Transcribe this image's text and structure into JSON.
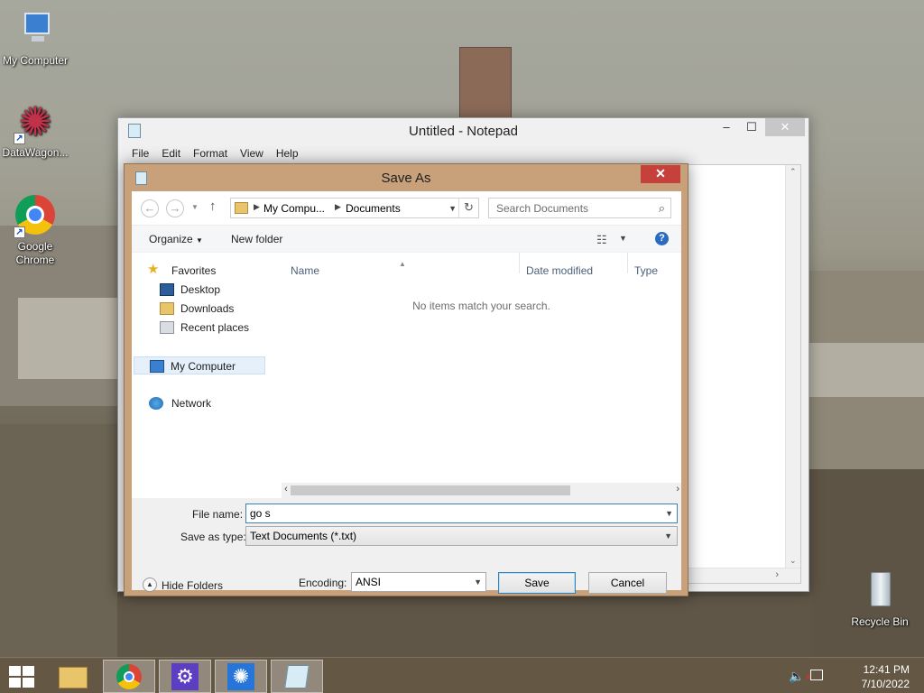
{
  "desktop": {
    "icons": [
      {
        "label": "My Computer"
      },
      {
        "label": "DataWagon..."
      },
      {
        "label": "Google Chrome"
      },
      {
        "label": "Recycle Bin"
      }
    ]
  },
  "notepad": {
    "title": "Untitled - Notepad",
    "menu": [
      "File",
      "Edit",
      "Format",
      "View",
      "Help"
    ],
    "controls": {
      "minimize": "‒",
      "maximize": "☐",
      "close": "✕"
    }
  },
  "dialog": {
    "title": "Save As",
    "close": "✕",
    "address": {
      "crumbs": [
        "My Compu...",
        "Documents"
      ]
    },
    "search": {
      "placeholder": "Search Documents"
    },
    "toolbar": {
      "organize": "Organize",
      "new_folder": "New folder"
    },
    "nav": {
      "favorites": "Favorites",
      "desktop": "Desktop",
      "downloads": "Downloads",
      "recent": "Recent places",
      "my_computer": "My Computer",
      "network": "Network"
    },
    "columns": [
      "Name",
      "Date modified",
      "Type"
    ],
    "empty_message": "No items match your search.",
    "form": {
      "file_name_label": "File name:",
      "file_name_value": "go s",
      "save_type_label": "Save as type:",
      "save_type_value": "Text Documents (*.txt)",
      "encoding_label": "Encoding:",
      "encoding_value": "ANSI",
      "save_button": "Save",
      "cancel_button": "Cancel",
      "hide_folders": "Hide Folders"
    }
  },
  "taskbar": {
    "time": "12:41 PM",
    "date": "7/10/2022"
  },
  "colors": {
    "dialog_frame": "#c8a079",
    "close_red": "#c7413c",
    "selection": "#e5f0fb",
    "taskbar": "#695a46"
  }
}
